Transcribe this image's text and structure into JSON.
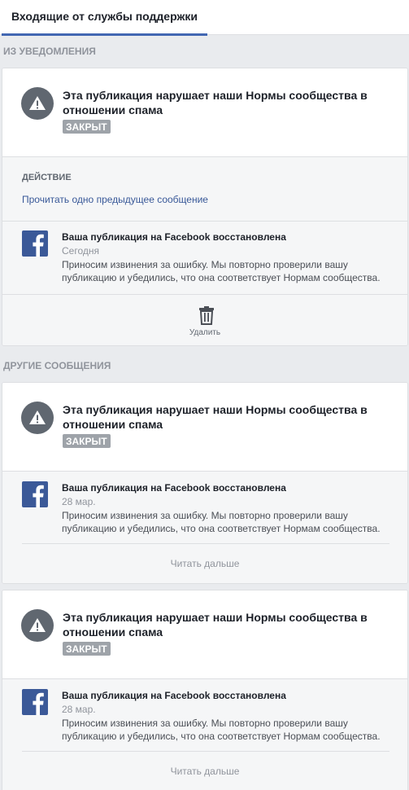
{
  "tab": {
    "label": "Входящие от службы поддержки"
  },
  "sections": {
    "notifications": "ИЗ УВЕДОМЛЕНИЯ",
    "other": "ДРУГИЕ СООБЩЕНИЯ"
  },
  "cards": [
    {
      "title": "Эта публикация нарушает наши Нормы сообщества в отношении спама",
      "status": "ЗАКРЫТ",
      "action_label": "ДЕЙСТВИЕ",
      "action_link": "Прочитать одно предыдущее сообщение",
      "message": {
        "title": "Ваша публикация на Facebook восстановлена",
        "date": "Сегодня",
        "body": "Приносим извинения за ошибку. Мы повторно проверили вашу публикацию и убедились, что она соответствует Нормам сообщества."
      },
      "delete_label": "Удалить"
    },
    {
      "title": "Эта публикация нарушает наши Нормы сообщества в отношении спама",
      "status": "ЗАКРЫТ",
      "message": {
        "title": "Ваша публикация на Facebook восстановлена",
        "date": "28 мар.",
        "body": "Приносим извинения за ошибку. Мы повторно проверили вашу публикацию и убедились, что она соответствует Нормам сообщества."
      },
      "read_more": "Читать дальше"
    },
    {
      "title": "Эта публикация нарушает наши Нормы сообщества в отношении спама",
      "status": "ЗАКРЫТ",
      "message": {
        "title": "Ваша публикация на Facebook восстановлена",
        "date": "28 мар.",
        "body": "Приносим извинения за ошибку. Мы повторно проверили вашу публикацию и убедились, что она соответствует Нормам сообщества."
      },
      "read_more": "Читать дальше"
    }
  ],
  "colors": {
    "accent": "#4267b2",
    "badge": "#9ea3a9",
    "link": "#385898",
    "facebook": "#3b5998"
  },
  "icons": {
    "warning": "warning-icon",
    "facebook": "facebook-logo-icon",
    "trash": "trash-icon"
  }
}
